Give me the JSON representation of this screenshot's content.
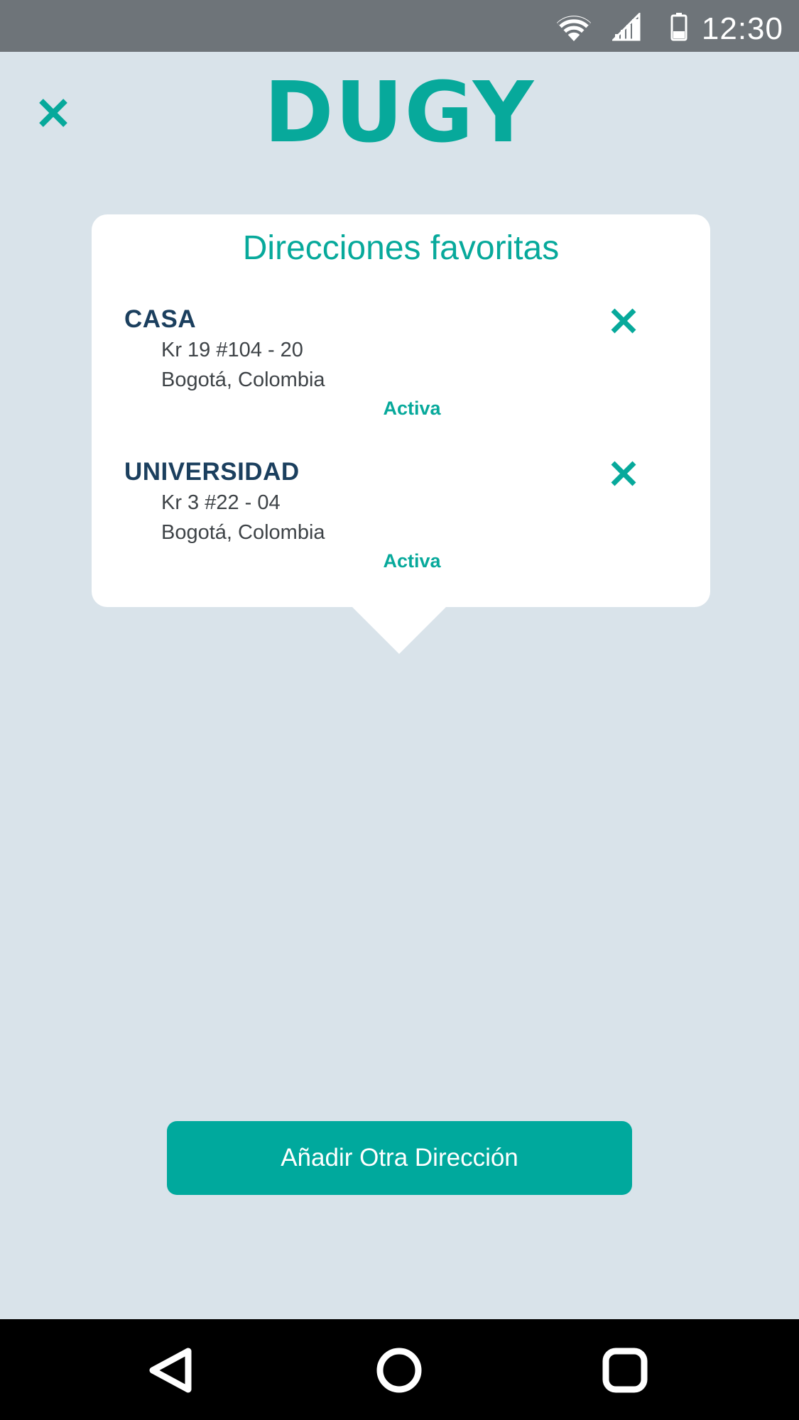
{
  "status_bar": {
    "time": "12:30",
    "icons": [
      "wifi-icon",
      "signal-icon",
      "battery-icon"
    ]
  },
  "header": {
    "logo_text": "DUGY",
    "close_icon": "close-icon"
  },
  "favorites": {
    "title": "Direcciones favoritas",
    "addresses": [
      {
        "name": "CASA",
        "line1": "Kr 19 #104 - 20",
        "line2": "Bogotá, Colombia",
        "status": "Activa",
        "remove_icon": "close-icon"
      },
      {
        "name": "UNIVERSIDAD",
        "line1": "Kr 3 #22 - 04",
        "line2": "Bogotá, Colombia",
        "status": "Activa",
        "remove_icon": "close-icon"
      }
    ]
  },
  "actions": {
    "add_label": "Añadir Otra Dirección"
  },
  "nav_bar": {
    "buttons": [
      "back-icon",
      "home-icon",
      "recents-icon"
    ]
  },
  "colors": {
    "accent": "#07a99b",
    "button": "#00a99d",
    "background": "#d9e3ea",
    "address_name": "#1b3f5e",
    "status_bar": "#6e7479"
  }
}
